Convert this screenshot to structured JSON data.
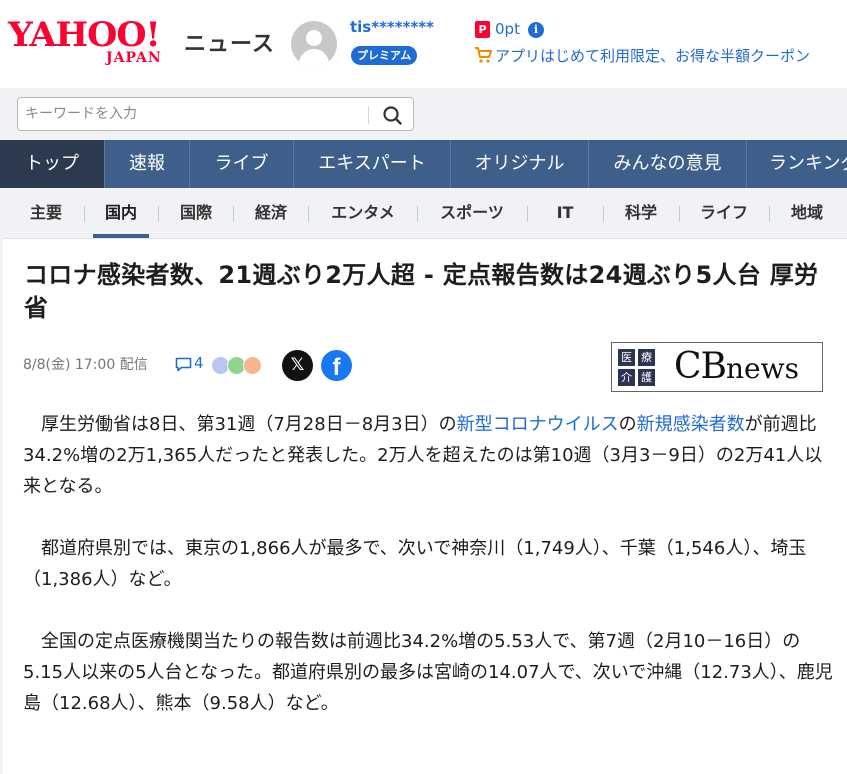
{
  "header": {
    "logo_main": "YAHOO!",
    "logo_sub": "JAPAN",
    "section_label": "ニュース",
    "username": "tis********",
    "premium_badge": "プレミアム",
    "points_icon": "P",
    "points": "0pt",
    "info_icon": "i",
    "coupon_link": "アプリはじめて利用限定、お得な半額クーポン"
  },
  "search": {
    "placeholder": "キーワードを入力"
  },
  "nav": {
    "items": [
      "トップ",
      "速報",
      "ライブ",
      "エキスパート",
      "オリジナル",
      "みんなの意見",
      "ランキング"
    ],
    "active_index": 0
  },
  "subnav": {
    "items": [
      "主要",
      "国内",
      "国際",
      "経済",
      "エンタメ",
      "スポーツ",
      "IT",
      "科学",
      "ライフ",
      "地域"
    ],
    "active_index": 1
  },
  "article": {
    "title": "コロナ感染者数、21週ぶり2万人超 - 定点報告数は24週ぶり5人台 厚労省",
    "meta": "8/8(金) 17:00 配信",
    "comment_count": "4",
    "share_x": "𝕏",
    "share_facebook": "f",
    "source_logo": {
      "grid": [
        "医",
        "療",
        "介",
        "護"
      ],
      "text_main": "CB",
      "text_small": "news"
    },
    "paragraphs": [
      {
        "before": "厚生労働省は8日、第31週（7月28日－8月3日）の",
        "link1": "新型コロナウイルス",
        "middle": "の",
        "link2": "新規感染者数",
        "after": "が前週比34.2%増の2万1,365人だったと発表した。2万人を超えたのは第10週（3月3－9日）の2万41人以来となる。"
      },
      {
        "text": "都道府県別では、東京の1,866人が最多で、次いで神奈川（1,749人）、千葉（1,546人）、埼玉（1,386人）など。"
      },
      {
        "text": "全国の定点医療機関当たりの報告数は前週比34.2%増の5.53人で、第7週（2月10－16日）の5.15人以来の5人台となった。都道府県別の最多は宮崎の14.07人で、次いで沖縄（12.73人）、鹿児島（12.68人）、熊本（9.58人）など。"
      }
    ]
  },
  "colors": {
    "brand_red": "#ff0033",
    "nav_blue": "#3e5f8a",
    "nav_active": "#2c3a50",
    "link_blue": "#1f6bd4",
    "reaction_colors": [
      "#b7c7f2",
      "#8fd48f",
      "#f5b78a"
    ]
  },
  "icons": {
    "avatar": "user-silhouette-icon",
    "search": "magnifier-icon",
    "comment": "speech-bubble-icon",
    "cart": "shopping-cart-icon"
  }
}
